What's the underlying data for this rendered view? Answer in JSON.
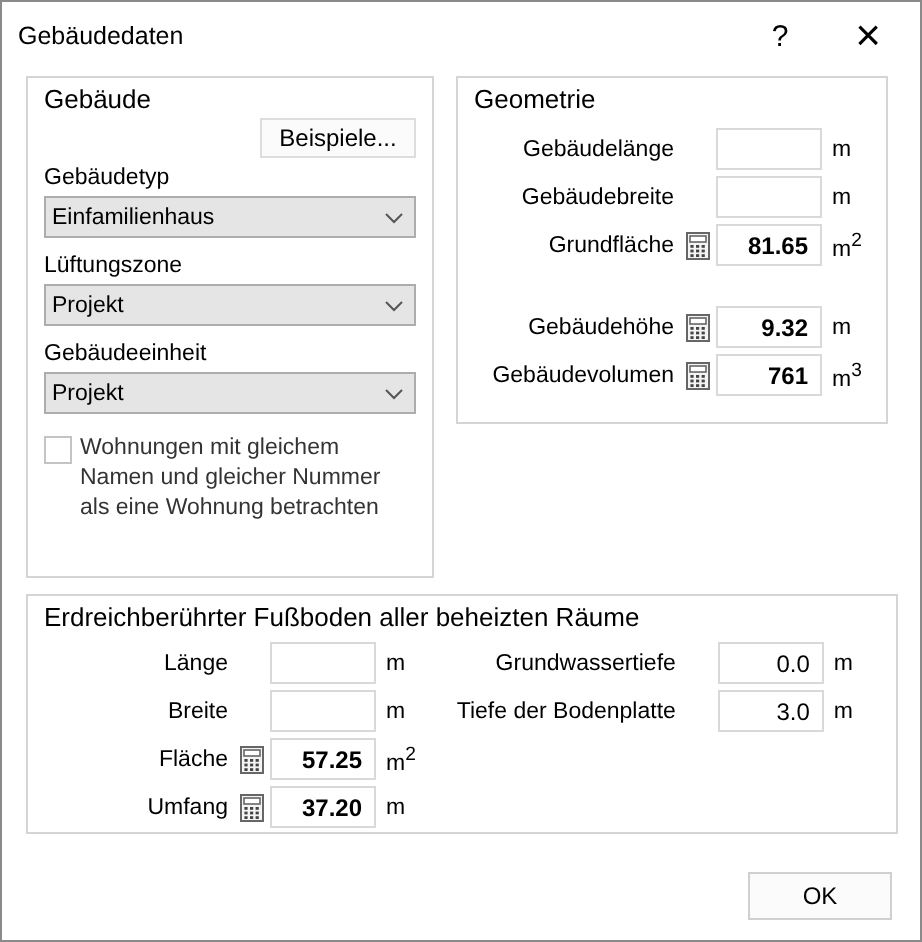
{
  "window": {
    "title": "Gebäudedaten",
    "help": "?",
    "close": "×"
  },
  "building": {
    "title": "Gebäude",
    "examples_button": "Beispiele...",
    "dropdowns": [
      {
        "label": "Gebäudetyp",
        "value": "Einfamilienhaus"
      },
      {
        "label": "Lüftungszone",
        "value": "Projekt"
      },
      {
        "label": "Gebäudeeinheit",
        "value": "Projekt"
      }
    ],
    "checkbox": {
      "label": "Wohnungen mit gleichem Namen und gleicher Nummer als eine Wohnung betrachten",
      "checked": false
    }
  },
  "geometry": {
    "title": "Geometrie",
    "sections": [
      [
        {
          "label": "Gebäudelänge",
          "calculated": false,
          "unit": "m"
        },
        {
          "label": "Gebäudebreite",
          "calculated": false,
          "unit": "m"
        },
        {
          "label": "Grundfläche",
          "calculated": true,
          "value": "81.65",
          "unit": "m$^{2}$"
        }
      ],
      [
        {
          "label": "Gebäudehöhe",
          "calculated": true,
          "value": "9.32",
          "unit": "m"
        },
        {
          "label": "Gebäudevolumen",
          "calculated": true,
          "value": "761",
          "unit": "m$^{3}$"
        }
      ]
    ]
  },
  "floor": {
    "title": "Erdreichberührter Fußboden aller beheizten Räume",
    "left": [
      {
        "label": "Länge",
        "calculated": false,
        "unit": "m"
      },
      {
        "label": "Breite",
        "calculated": false,
        "unit": "m"
      },
      {
        "label": "Fläche",
        "calculated": true,
        "value": "57.25",
        "unit": "m$^{2}$"
      },
      {
        "label": "Umfang",
        "calculated": true,
        "value": "37.20",
        "unit": "m"
      }
    ],
    "right": [
      {
        "label": "Grundwassertiefe",
        "calculated": false,
        "value": "0.0",
        "unit": "m"
      },
      {
        "label": "Tiefe der Bodenplatte",
        "calculated": false,
        "value": "3.0",
        "unit": "m"
      }
    ]
  },
  "buttons": [
    "OK"
  ]
}
